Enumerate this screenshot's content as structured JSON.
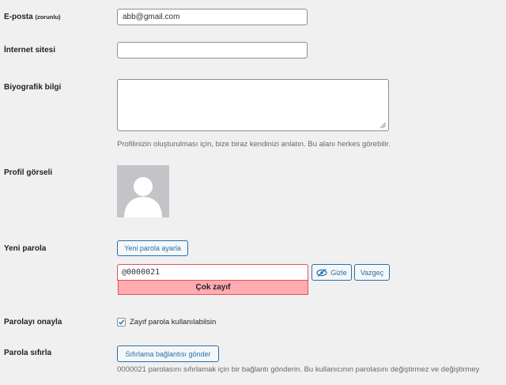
{
  "email": {
    "label": "E-posta",
    "required": "(zorunlu)",
    "value": "abb@gmail.com"
  },
  "website": {
    "label": "İnternet sitesi",
    "value": ""
  },
  "bio": {
    "label": "Biyografik bilgi",
    "value": "",
    "description": "Profilinizin oluşturulması için, bize biraz kendinizi anlatın. Bu alanı herkes görebilir."
  },
  "avatar": {
    "label": "Profil görseli"
  },
  "new_password": {
    "label": "Yeni parola",
    "generate_button": "Yeni parola ayarla",
    "value": "@0000021",
    "hide_button": "Gizle",
    "cancel_button": "Vazgeç",
    "strength": "Çok zayıf",
    "strength_color": "#ffabaf"
  },
  "confirm": {
    "label": "Parolayı onayla",
    "checkbox_label": "Zayıf parola kullanılabilsin",
    "checked": true
  },
  "reset": {
    "label": "Parola sıfırla",
    "button": "Sıfırlama bağlantısı gönder",
    "description": "0000021 parolasını sıfırlamak için bir bağlantı gönderin. Bu kullanıcının parolasını değiştirmez ve değiştirmey"
  },
  "colors": {
    "accent": "#2271b1",
    "background": "#f0f0f1",
    "weak": "#e65054"
  }
}
